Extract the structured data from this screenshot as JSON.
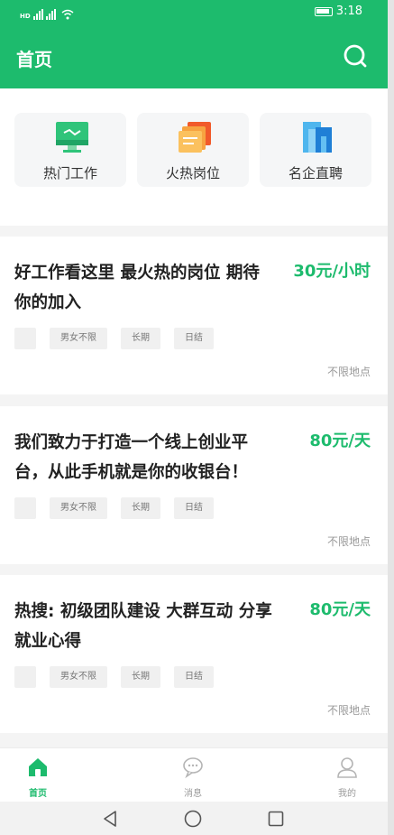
{
  "status_bar": {
    "left_text": "HD",
    "time": "3:18"
  },
  "header": {
    "title": "首页"
  },
  "categories": [
    {
      "label": "热门工作",
      "icon": "monitor-icon"
    },
    {
      "label": "火热岗位",
      "icon": "documents-icon"
    },
    {
      "label": "名企直聘",
      "icon": "building-icon"
    }
  ],
  "jobs": [
    {
      "title": "好工作看这里 最火热的岗位 期待你的加入",
      "salary": "30元/小时",
      "tags": [
        "男女不限",
        "长期",
        "日结"
      ],
      "location": "不限地点"
    },
    {
      "title": "我们致力于打造一个线上创业平台，从此手机就是你的收银台！",
      "salary": "80元/天",
      "tags": [
        "男女不限",
        "长期",
        "日结"
      ],
      "location": "不限地点"
    },
    {
      "title": "热搜: 初级团队建设 大群互动 分享就业心得",
      "salary": "80元/天",
      "tags": [
        "男女不限",
        "长期",
        "日结"
      ],
      "location": "不限地点"
    }
  ],
  "tabbar": {
    "items": [
      {
        "label": "首页",
        "icon": "home-icon",
        "active": true
      },
      {
        "label": "消息",
        "icon": "chat-bubble-icon",
        "active": false
      },
      {
        "label": "我的",
        "icon": "user-icon",
        "active": false
      }
    ]
  },
  "colors": {
    "brand": "#1dbb6d",
    "salary": "#1dbb6d",
    "tag_bg": "#f0f0f0"
  }
}
